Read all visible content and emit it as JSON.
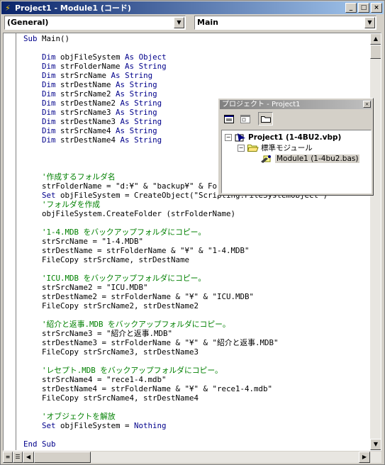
{
  "window": {
    "title": "Project1 - Module1 (コード)"
  },
  "combos": {
    "object": "(General)",
    "procedure": "Main"
  },
  "code_lines": [
    [
      {
        "t": "Sub Main()",
        "c": "kw"
      }
    ],
    [
      {
        "t": "",
        "c": ""
      }
    ],
    [
      {
        "t": "    Dim objFileSystem As Object",
        "c": "kw"
      }
    ],
    [
      {
        "t": "    Dim strFolderName As String",
        "c": "kw"
      }
    ],
    [
      {
        "t": "    Dim strSrcName As String",
        "c": "kw"
      }
    ],
    [
      {
        "t": "    Dim strDestName As String",
        "c": "kw"
      }
    ],
    [
      {
        "t": "    Dim strSrcName2 As String",
        "c": "kw"
      }
    ],
    [
      {
        "t": "    Dim strDestName2 As String",
        "c": "kw"
      }
    ],
    [
      {
        "t": "    Dim strSrcName3 As String",
        "c": "kw"
      }
    ],
    [
      {
        "t": "    Dim strDestName3 As String",
        "c": "kw"
      }
    ],
    [
      {
        "t": "    Dim strSrcName4 As String",
        "c": "kw"
      }
    ],
    [
      {
        "t": "    Dim strDestName4 As String",
        "c": "kw"
      }
    ],
    [
      {
        "t": "",
        "c": ""
      }
    ],
    [
      {
        "t": "",
        "c": ""
      }
    ],
    [
      {
        "t": "",
        "c": ""
      }
    ],
    [
      {
        "t": "    '作成するフォルダ名",
        "c": "cm"
      }
    ],
    [
      {
        "t": "    strFolderName = \"d:¥\" & \"backup¥\" & Format(Date, \"Long Date\")",
        "c": ""
      }
    ],
    [
      {
        "t": "    Set objFileSystem = CreateObject(\"Scripting.FileSystemObject\")",
        "c": ""
      }
    ],
    [
      {
        "t": "    'フォルダを作成",
        "c": "cm"
      }
    ],
    [
      {
        "t": "    objFileSystem.CreateFolder (strFolderName)",
        "c": ""
      }
    ],
    [
      {
        "t": "",
        "c": ""
      }
    ],
    [
      {
        "t": "    '1-4.MDB をバックアップフォルダにコピー。",
        "c": "cm"
      }
    ],
    [
      {
        "t": "    strSrcName = \"1-4.MDB\"",
        "c": ""
      }
    ],
    [
      {
        "t": "    strDestName = strFolderName & \"¥\" & \"1-4.MDB\"",
        "c": ""
      }
    ],
    [
      {
        "t": "    FileCopy strSrcName, strDestName",
        "c": ""
      }
    ],
    [
      {
        "t": "",
        "c": ""
      }
    ],
    [
      {
        "t": "    'ICU.MDB をバックアップフォルダにコピー。",
        "c": "cm"
      }
    ],
    [
      {
        "t": "    strSrcName2 = \"ICU.MDB\"",
        "c": ""
      }
    ],
    [
      {
        "t": "    strDestName2 = strFolderName & \"¥\" & \"ICU.MDB\"",
        "c": ""
      }
    ],
    [
      {
        "t": "    FileCopy strSrcName2, strDestName2",
        "c": ""
      }
    ],
    [
      {
        "t": "",
        "c": ""
      }
    ],
    [
      {
        "t": "    '紹介と返事.MDB をバックアップフォルダにコピー。",
        "c": "cm"
      }
    ],
    [
      {
        "t": "    strSrcName3 = \"紹介と返事.MDB\"",
        "c": ""
      }
    ],
    [
      {
        "t": "    strDestName3 = strFolderName & \"¥\" & \"紹介と返事.MDB\"",
        "c": ""
      }
    ],
    [
      {
        "t": "    FileCopy strSrcName3, strDestName3",
        "c": ""
      }
    ],
    [
      {
        "t": "",
        "c": ""
      }
    ],
    [
      {
        "t": "    'レセプト.MDB をバックアップフォルダにコピー。",
        "c": "cm"
      }
    ],
    [
      {
        "t": "    strSrcName4 = \"rece1-4.mdb\"",
        "c": ""
      }
    ],
    [
      {
        "t": "    strDestName4 = strFolderName & \"¥\" & \"rece1-4.mdb\"",
        "c": ""
      }
    ],
    [
      {
        "t": "    FileCopy strSrcName4, strDestName4",
        "c": ""
      }
    ],
    [
      {
        "t": "",
        "c": ""
      }
    ],
    [
      {
        "t": "    'オブジェクトを解放",
        "c": "cm"
      }
    ],
    [
      {
        "t": "    Set objFileSystem = Nothing",
        "c": "mixed"
      }
    ],
    [
      {
        "t": "",
        "c": ""
      }
    ],
    [
      {
        "t": "End Sub",
        "c": "kw"
      }
    ]
  ],
  "project_explorer": {
    "title": "プロジェクト - Project1",
    "project": "Project1 (1-4BU2.vbp)",
    "folder": "標準モジュール",
    "module": "Module1 (1-4bu2.bas)"
  },
  "colors": {
    "keyword": "#00008b",
    "comment": "#008000",
    "title_start": "#0a246a",
    "title_end": "#a6caf0"
  }
}
